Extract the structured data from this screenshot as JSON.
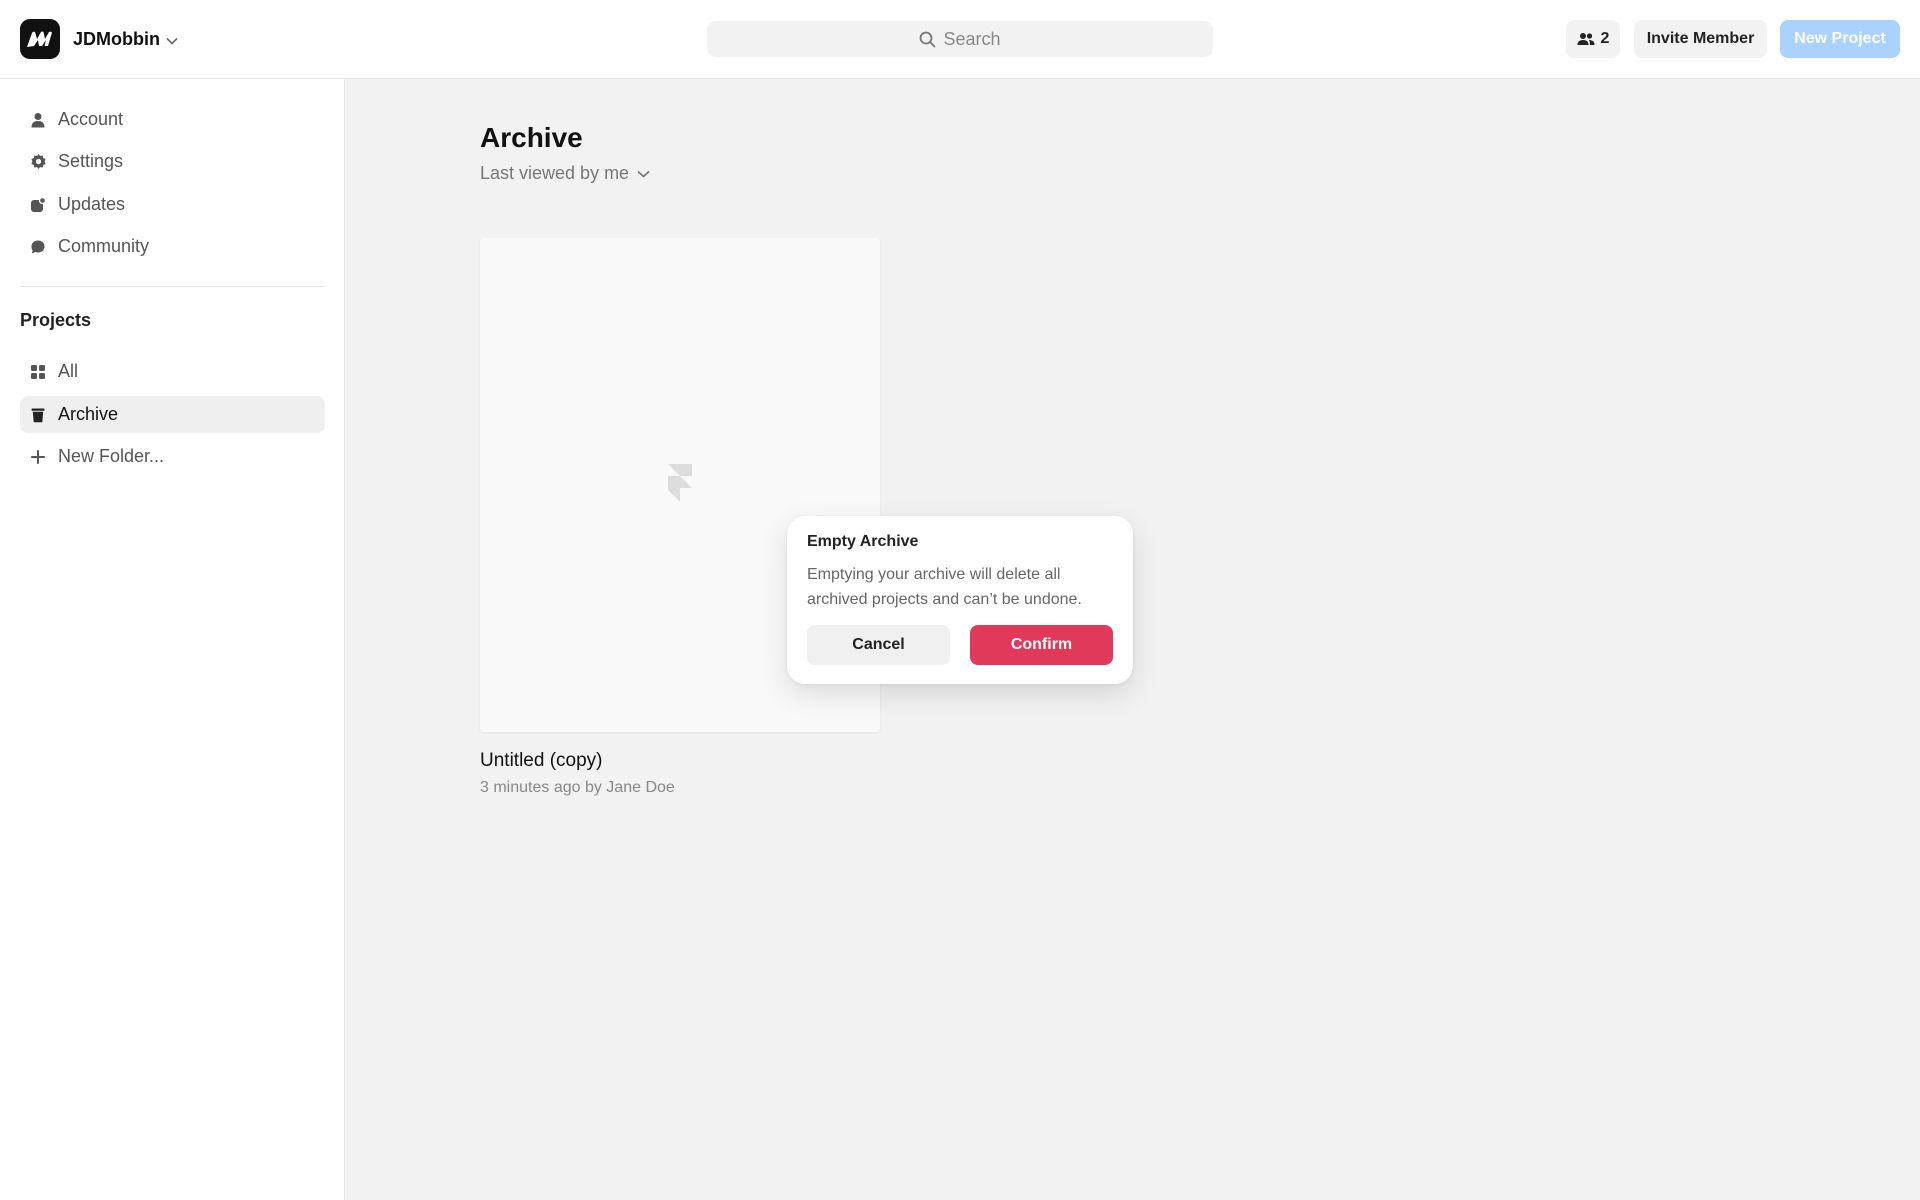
{
  "header": {
    "workspace_name": "JDMobbin",
    "search_placeholder": "Search",
    "member_count": "2",
    "invite_label": "Invite Member",
    "new_project_label": "New Project"
  },
  "sidebar": {
    "nav": [
      {
        "label": "Account",
        "icon": "user-icon"
      },
      {
        "label": "Settings",
        "icon": "gear-icon"
      },
      {
        "label": "Updates",
        "icon": "updates-icon"
      },
      {
        "label": "Community",
        "icon": "chat-bubble-icon"
      }
    ],
    "projects_title": "Projects",
    "projects": [
      {
        "label": "All",
        "icon": "grid-icon"
      },
      {
        "label": "Archive",
        "icon": "trash-icon",
        "active": true
      },
      {
        "label": "New Folder...",
        "icon": "plus-icon"
      }
    ]
  },
  "main": {
    "title": "Archive",
    "sort_label": "Last viewed by me",
    "project": {
      "title": "Untitled (copy)",
      "meta": "3 minutes ago by Jane Doe"
    }
  },
  "dialog": {
    "title": "Empty Archive",
    "body": "Emptying your archive will delete all archived projects and can’t be undone.",
    "cancel_label": "Cancel",
    "confirm_label": "Confirm"
  },
  "colors": {
    "accent_disabled": "#a9d2ff",
    "danger": "#e0395a",
    "background": "#f2f2f2"
  }
}
